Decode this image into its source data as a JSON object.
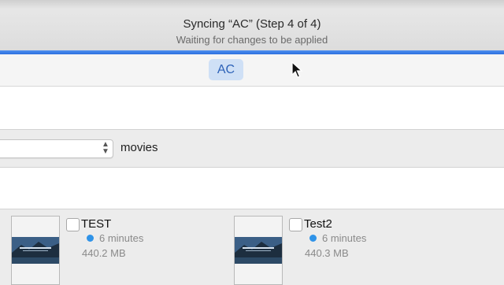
{
  "sync": {
    "title": "Syncing “AC” (Step 4 of 4)",
    "subtitle": "Waiting for changes to be applied",
    "progress": 1.0
  },
  "device_tab": {
    "label": "AC"
  },
  "filter": {
    "label": "movies"
  },
  "items": [
    {
      "title": "TEST",
      "duration": "6 minutes",
      "size": "440.2 MB"
    },
    {
      "title": "Test2",
      "duration": "6 minutes",
      "size": "440.3 MB"
    }
  ],
  "colors": {
    "accent": "#2c6fde",
    "tab_bg": "#cfe0f6",
    "status_dot": "#2f93e8"
  }
}
